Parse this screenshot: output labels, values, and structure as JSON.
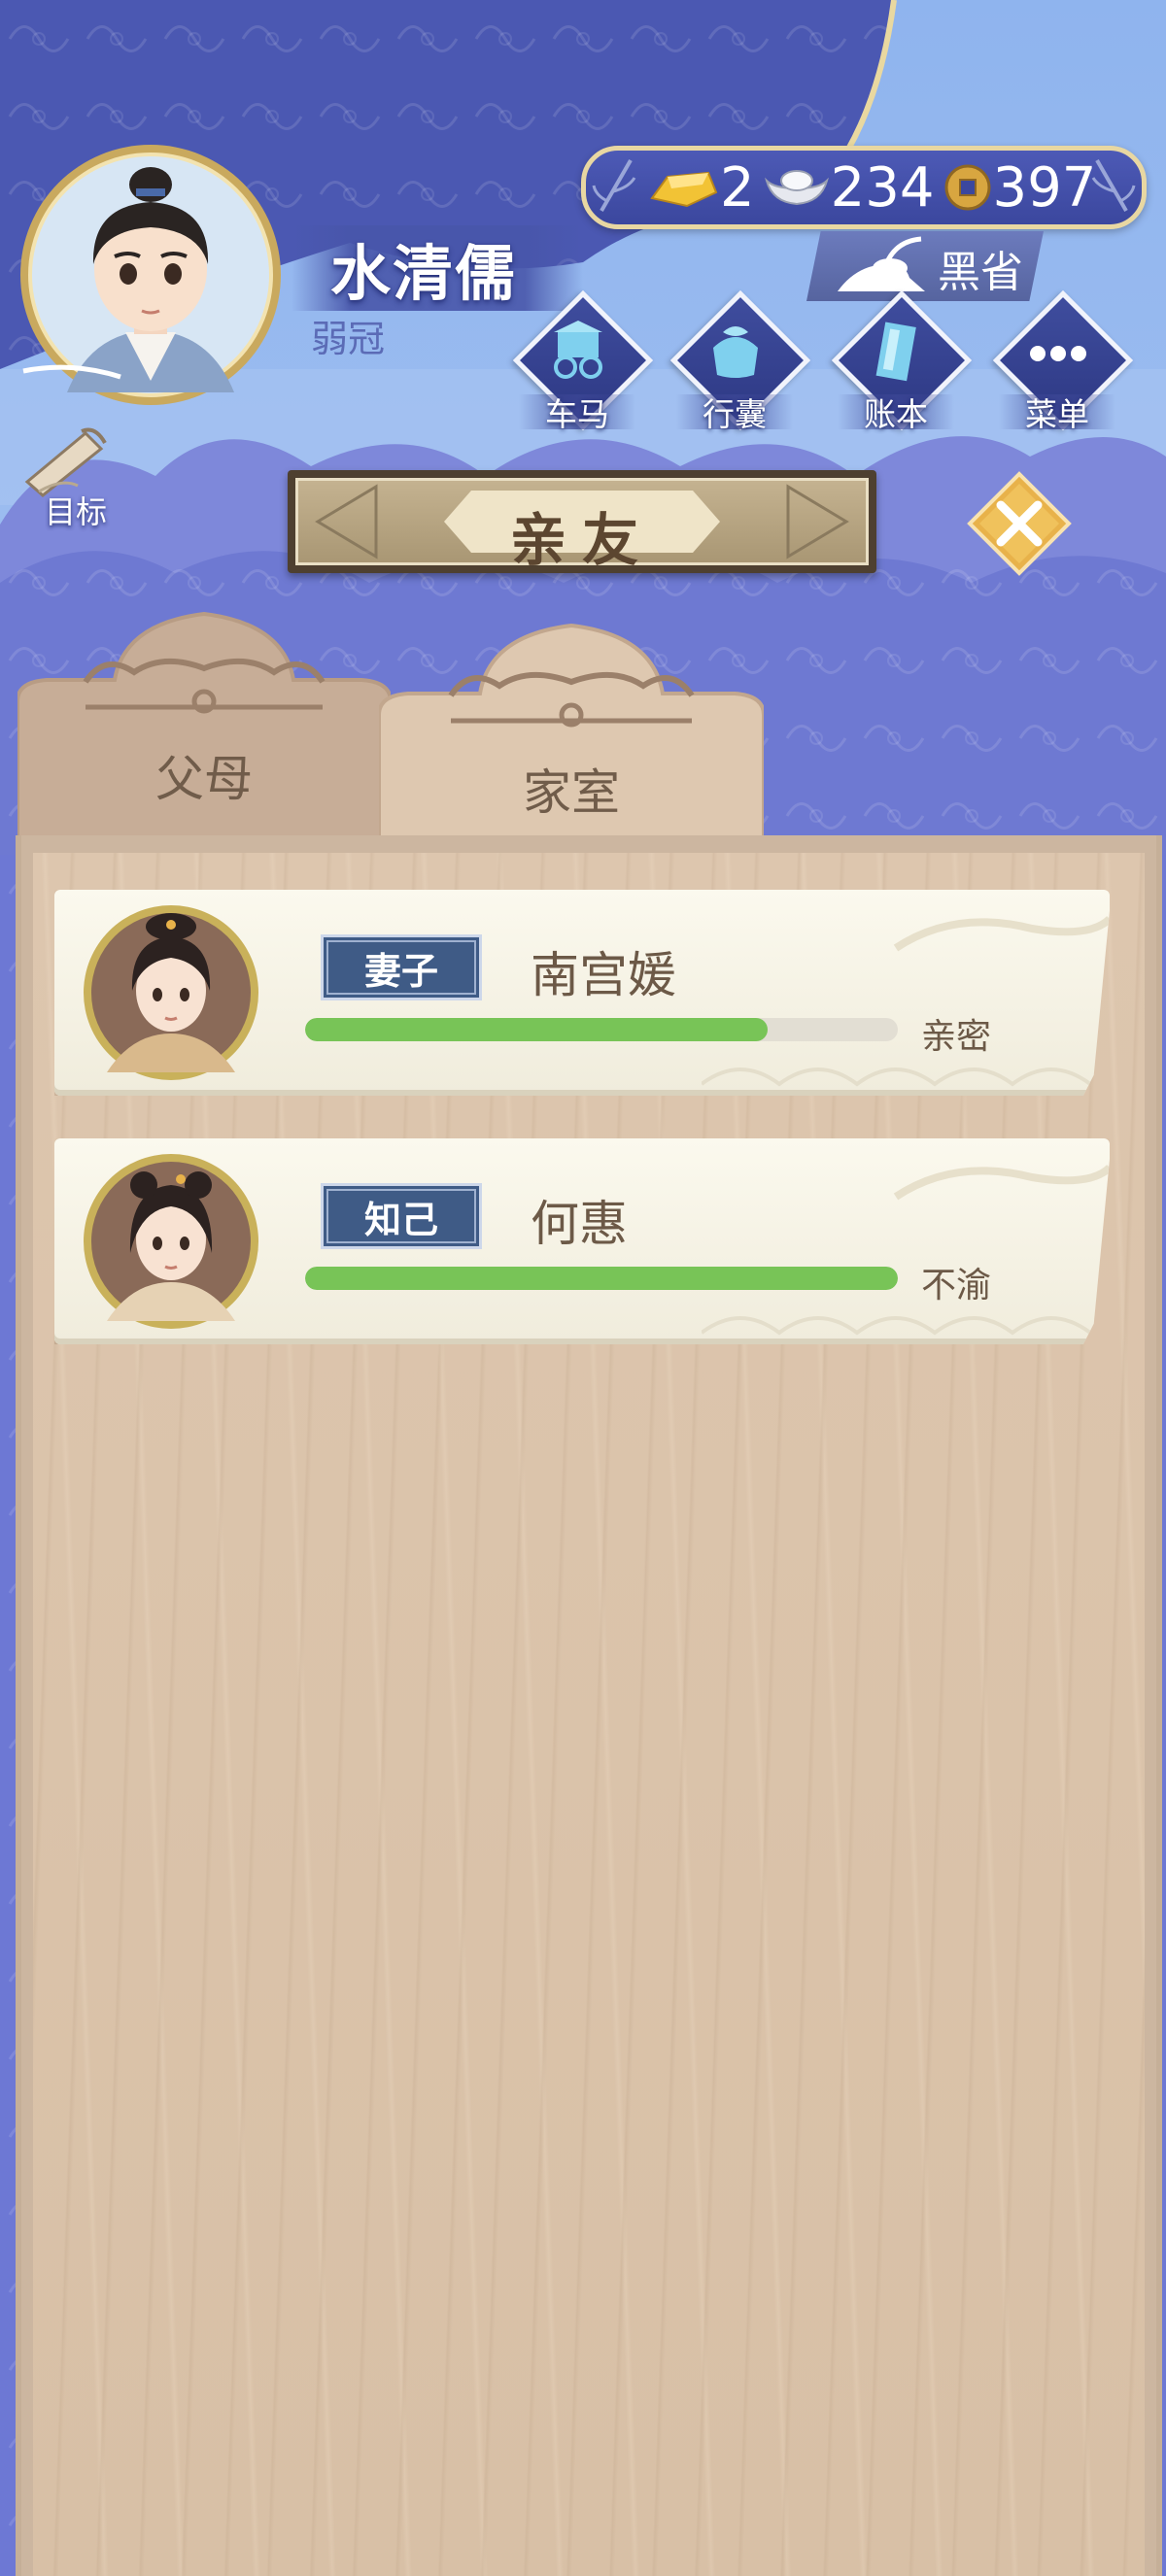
{
  "player": {
    "name": "水清儒",
    "age_title": "弱冠"
  },
  "currency": {
    "gold": "2",
    "silver": "234",
    "copper": "397"
  },
  "province": "黑省",
  "menu": [
    {
      "label": "车马",
      "icon": "carriage-icon"
    },
    {
      "label": "行囊",
      "icon": "bundle-icon"
    },
    {
      "label": "账本",
      "icon": "ledger-icon"
    },
    {
      "label": "菜单",
      "icon": "more-icon"
    }
  ],
  "goal_label": "目标",
  "page_title": "亲友",
  "tabs": [
    {
      "label": "父母",
      "active": false
    },
    {
      "label": "家室",
      "active": true
    }
  ],
  "relations": [
    {
      "role": "妻子",
      "name": "南宫媛",
      "status": "亲密",
      "affinity": 0.78
    },
    {
      "role": "知己",
      "name": "何惠",
      "status": "不渝",
      "affinity": 1.0
    }
  ],
  "colors": {
    "sky": "#8fb4ee",
    "cloud": "#6b78d6",
    "panel": "#d8c0a6",
    "badge": "#3f5b86",
    "bar": "#78c457",
    "gold_accent": "#e8b24a"
  }
}
